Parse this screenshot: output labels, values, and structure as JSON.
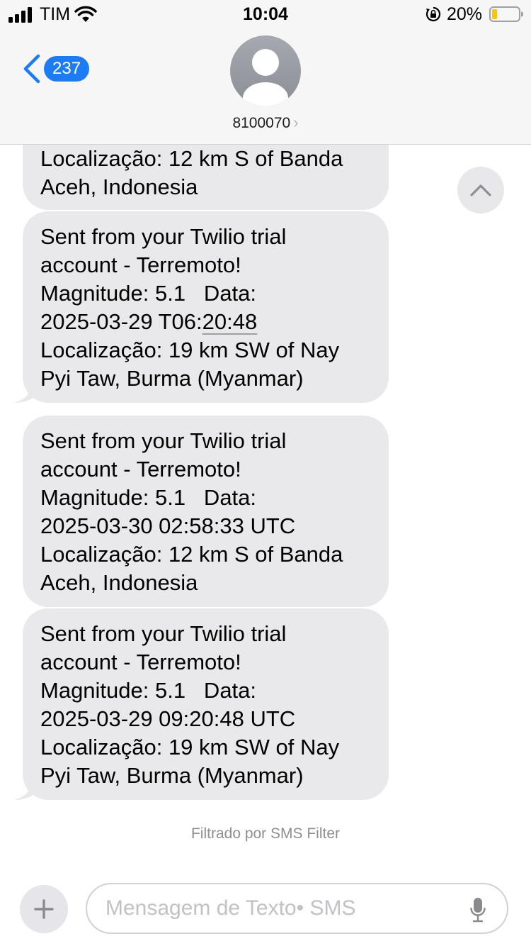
{
  "status_bar": {
    "carrier": "TIM",
    "time": "10:04",
    "battery_percent": "20%",
    "battery_level": 0.2,
    "icons": [
      "signal-icon",
      "wifi-icon",
      "orientation-lock-icon",
      "battery-icon"
    ]
  },
  "header": {
    "back_badge": "237",
    "contact_name": "8100070",
    "contact_chevron": "›",
    "icons": [
      "back-chevron-icon",
      "avatar-icon",
      "chevron-right-icon"
    ]
  },
  "messages": [
    {
      "lines": [
        "Localização: 12 km S of Banda",
        "Aceh, Indonesia"
      ]
    },
    {
      "lines": [
        "Sent from your Twilio trial",
        "account - Terremoto!",
        "Magnitude: 5.1   Data:",
        "2025-03-29 T06:",
        "Localização: 19 km SW of Nay",
        "Pyi Taw, Burma (Myanmar)"
      ],
      "time_link": "20:48"
    },
    {
      "lines": [
        "Sent from your Twilio trial",
        "account - Terremoto!",
        "Magnitude: 5.1   Data:",
        "2025-03-30 02:58:33 UTC",
        "Localização: 12 km S of Banda",
        "Aceh, Indonesia"
      ]
    },
    {
      "lines": [
        "Sent from your Twilio trial",
        "account - Terremoto!",
        "Magnitude: 5.1   Data:",
        "2025-03-29 09:20:48 UTC",
        "Localização: 19 km SW of Nay",
        "Pyi Taw, Burma (Myanmar)"
      ]
    }
  ],
  "filter_note": "Filtrado por SMS Filter",
  "composer": {
    "placeholder": "Mensagem de Texto• SMS",
    "icons": [
      "plus-icon",
      "microphone-icon",
      "scroll-up-chevron-icon"
    ]
  },
  "colors": {
    "accent": "#1e7cf2",
    "bubble_received": "#e9e9eb",
    "header_bg": "#f6f6f6",
    "battery_low": "#f5c800"
  }
}
